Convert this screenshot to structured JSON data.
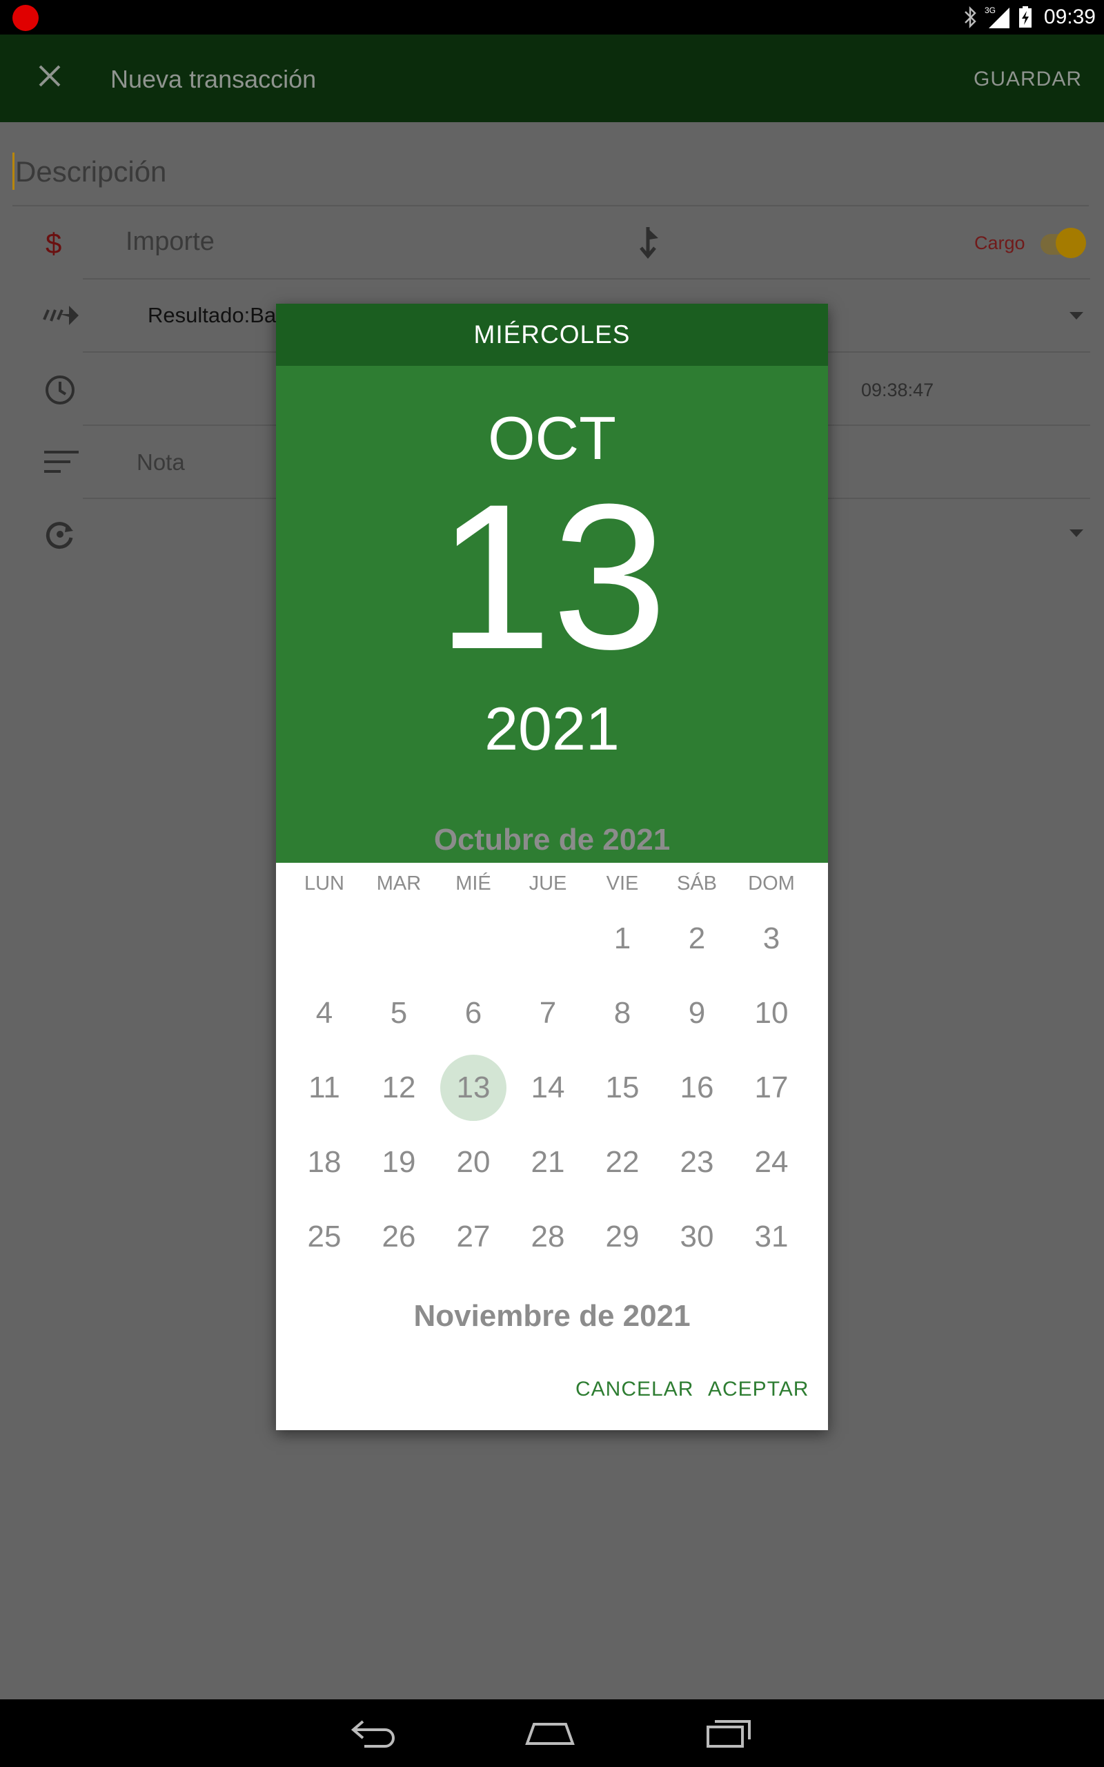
{
  "status_bar": {
    "time": "09:39",
    "network": "3G",
    "icons": [
      "record-dot-icon",
      "bluetooth-icon",
      "signal-icon",
      "battery-charging-icon"
    ]
  },
  "app_bar": {
    "title": "Nueva transacción",
    "save_label": "GUARDAR",
    "close_icon": "close-icon"
  },
  "form": {
    "description_placeholder": "Descripción",
    "amount_placeholder": "Importe",
    "currency_symbol": "$",
    "charge_label": "Cargo",
    "account_value": "Resultado:Ba",
    "time_value": "09:38:47",
    "note_placeholder": "Nota"
  },
  "date_picker": {
    "day_name": "MIÉRCOLES",
    "month_short": "OCT",
    "day": "13",
    "year": "2021",
    "month_title": "Octubre de 2021",
    "next_month_title": "Noviembre de 2021",
    "weekdays": [
      "LUN",
      "MAR",
      "MIÉ",
      "JUE",
      "VIE",
      "SÁB",
      "DOM"
    ],
    "selected_day": 13,
    "first_weekday_index": 4,
    "days_in_month": 31,
    "cancel_label": "CANCELAR",
    "accept_label": "ACEPTAR",
    "colors": {
      "header_dark": "#1b5e20",
      "header": "#2e7d32",
      "selected_circle": "#d3e5d4",
      "accent": "#2e7d32"
    }
  }
}
